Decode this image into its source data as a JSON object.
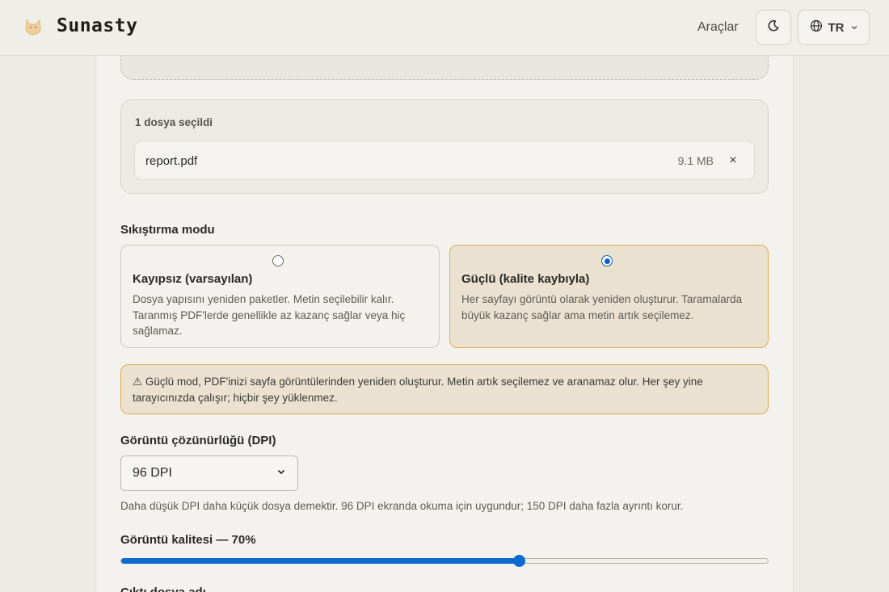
{
  "header": {
    "brand": "Sunasty",
    "nav_tools": "Araçlar",
    "lang": "TR"
  },
  "files": {
    "count_label": "1 dosya seçildi",
    "items": [
      {
        "name": "report.pdf",
        "size": "9.1 MB",
        "remove": "×"
      }
    ]
  },
  "compression": {
    "label": "Sıkıştırma modu",
    "options": [
      {
        "title": "Kayıpsız (varsayılan)",
        "description": "Dosya yapısını yeniden paketler. Metin seçilebilir kalır. Taranmış PDF'lerde genellikle az kazanç sağlar veya hiç sağlamaz.",
        "selected": false
      },
      {
        "title": "Güçlü (kalite kaybıyla)",
        "description": "Her sayfayı görüntü olarak yeniden oluşturur. Taramalarda büyük kazanç sağlar ama metin artık seçilemez.",
        "selected": true
      }
    ]
  },
  "warning": "⚠ Güçlü mod, PDF'inizi sayfa görüntülerinden yeniden oluşturur. Metin artık seçilemez ve aranamaz olur. Her şey yine tarayıcınızda çalışır; hiçbir şey yüklenmez.",
  "dpi": {
    "label": "Görüntü çözünürlüğü (DPI)",
    "selected": "96 DPI",
    "hint": "Daha düşük DPI daha küçük dosya demektir. 96 DPI ekranda okuma için uygundur; 150 DPI daha fazla ayrıntı korur."
  },
  "quality": {
    "label": "Görüntü kalitesi — 70%",
    "value": 0.615
  },
  "output": {
    "label": "Çıktı dosya adı"
  },
  "colors": {
    "accent": "#0b6bcf",
    "warning_border": "#e3aa47",
    "warning_bg": "#ebe1d1"
  },
  "icons": {
    "logo": "fox-logo-icon",
    "theme": "moon-icon",
    "language": "globe-icon",
    "language_caret": "chevron-down-icon",
    "remove": "close-icon"
  }
}
